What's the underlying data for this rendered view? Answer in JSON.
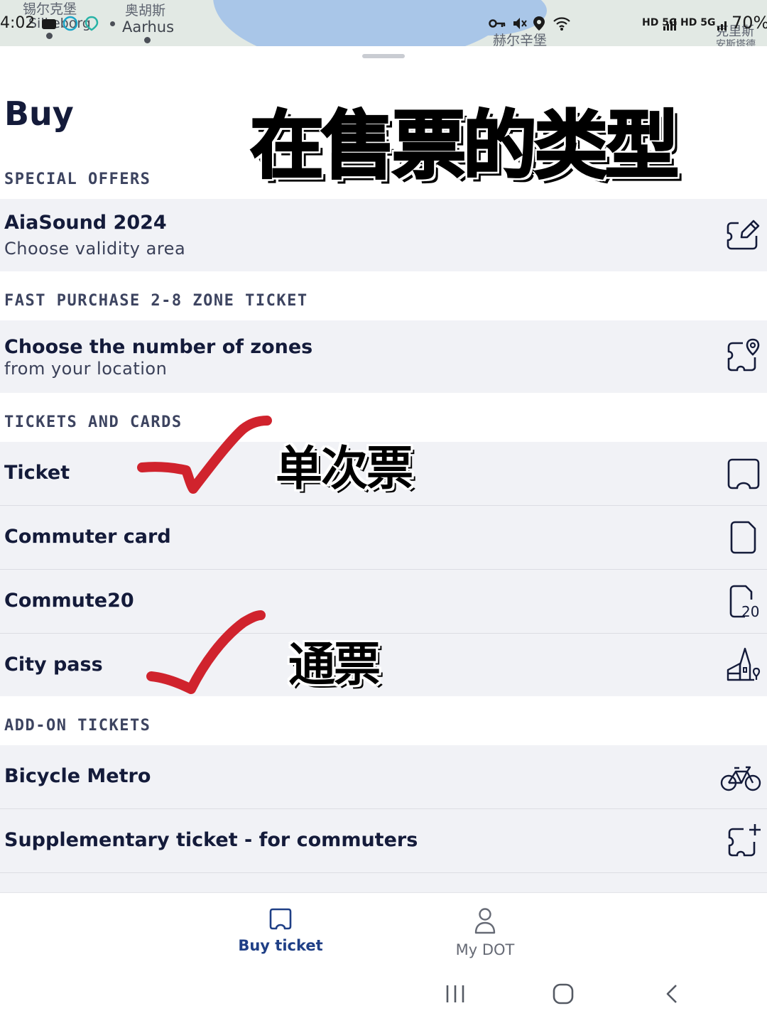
{
  "status_bar": {
    "time": "4:02",
    "map_labels": [
      "锡尔克堡",
      "Silkeborg",
      "奥胡斯",
      "Aarhus",
      "赫尔辛堡",
      "克里斯",
      "安斯塔德"
    ],
    "network_left": "HD 5G",
    "network_right": "HD 5G",
    "battery": "70%"
  },
  "header": {
    "title": "Buy"
  },
  "overlay": {
    "main_caption": "在售票的类型",
    "ticket_caption": "单次票",
    "citypass_caption": "通票"
  },
  "sections": {
    "special_offers": {
      "title": "SPECIAL OFFERS",
      "item_title": "AiaSound 2024",
      "item_sub": "Choose validity area"
    },
    "fast_purchase": {
      "title": "FAST PURCHASE 2-8 ZONE TICKET",
      "item_title": "Choose the number of zones",
      "item_sub": "from your location"
    },
    "tickets_and_cards": {
      "title": "TICKETS AND CARDS",
      "items": [
        "Ticket",
        "Commuter card",
        "Commute20",
        "City pass"
      ],
      "commute20_badge": "20"
    },
    "add_on": {
      "title": "ADD-ON TICKETS",
      "items": [
        "Bicycle Metro",
        "Supplementary ticket - for commuters"
      ]
    }
  },
  "bottom_nav": {
    "buy_ticket": "Buy ticket",
    "my_dot": "My DOT"
  },
  "colors": {
    "accent": "#1f3f86",
    "text": "#141b3a",
    "row_bg": "#f1f2f6",
    "check": "#d0232d"
  }
}
